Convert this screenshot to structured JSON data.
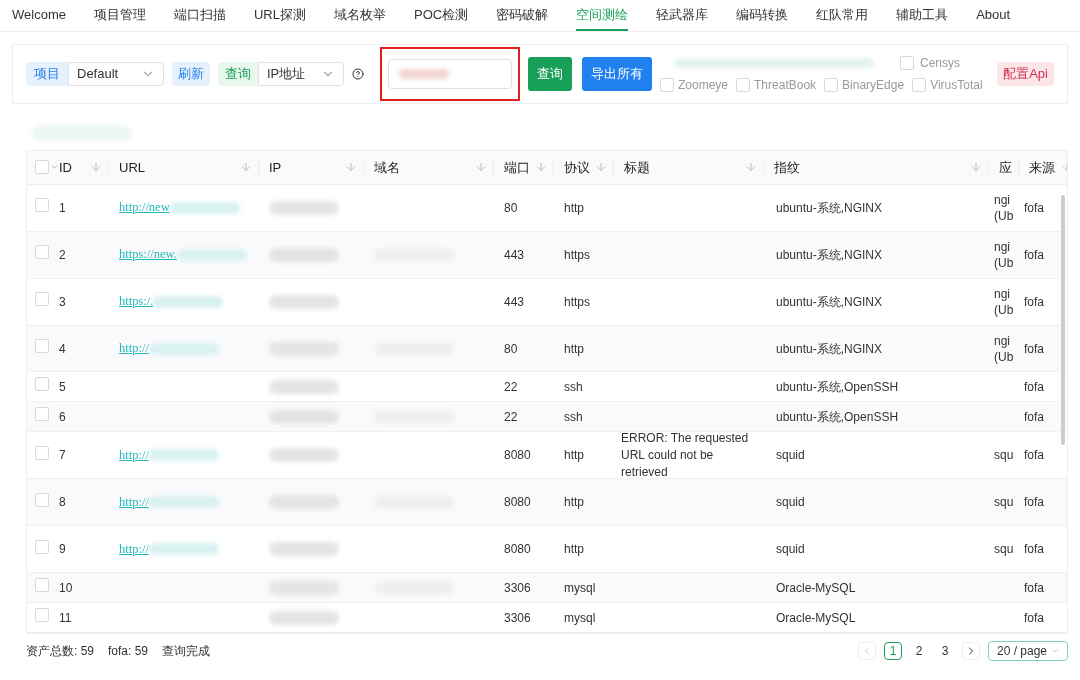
{
  "nav": [
    {
      "label": "Welcome",
      "selected": false
    },
    {
      "label": "项目管理",
      "selected": false
    },
    {
      "label": "端口扫描",
      "selected": false
    },
    {
      "label": "URL探测",
      "selected": false
    },
    {
      "label": "域名枚举",
      "selected": false
    },
    {
      "label": "POC检测",
      "selected": false
    },
    {
      "label": "密码破解",
      "selected": false
    },
    {
      "label": "空间测绘",
      "selected": true
    },
    {
      "label": "轻武器库",
      "selected": false
    },
    {
      "label": "编码转换",
      "selected": false
    },
    {
      "label": "红队常用",
      "selected": false
    },
    {
      "label": "辅助工具",
      "selected": false
    },
    {
      "label": "About",
      "selected": false
    }
  ],
  "toolbar": {
    "project": {
      "label": "项目",
      "value": "Default"
    },
    "refresh": "刷新",
    "query": {
      "label": "查询",
      "value": "IP地址"
    },
    "search_button": "查询",
    "export_button": "导出所有",
    "sources": [
      {
        "label": "Censys",
        "checked": false
      },
      {
        "label": "Zoomeye",
        "checked": false
      },
      {
        "label": "ThreatBook",
        "checked": false
      },
      {
        "label": "BinaryEdge",
        "checked": false
      },
      {
        "label": "VirusTotal",
        "checked": false
      }
    ],
    "config_button": "配置Api"
  },
  "table": {
    "all_checked": false,
    "columns": [
      "ID",
      "URL",
      "IP",
      "域名",
      "端口",
      "协议",
      "标题",
      "指纹",
      "应",
      "来源"
    ],
    "rows": [
      {
        "checked": false,
        "id": "1",
        "url": "http://new",
        "port": "80",
        "protocol": "http",
        "title": "",
        "fingerprint": "ubuntu-系统,NGINX",
        "app": "ngi (Ub",
        "source": "fofa"
      },
      {
        "checked": false,
        "id": "2",
        "url": "https://new.",
        "port": "443",
        "protocol": "https",
        "title": "",
        "fingerprint": "ubuntu-系统,NGINX",
        "app": "ngi (Ub",
        "source": "fofa"
      },
      {
        "checked": false,
        "id": "3",
        "url": "https:/.",
        "port": "443",
        "protocol": "https",
        "title": "",
        "fingerprint": "ubuntu-系统,NGINX",
        "app": "ngi (Ub",
        "source": "fofa"
      },
      {
        "checked": false,
        "id": "4",
        "url": "http://",
        "port": "80",
        "protocol": "http",
        "title": "",
        "fingerprint": "ubuntu-系统,NGINX",
        "app": "ngi (Ub",
        "source": "fofa"
      },
      {
        "checked": false,
        "id": "5",
        "url": "",
        "port": "22",
        "protocol": "ssh",
        "title": "",
        "fingerprint": "ubuntu-系统,OpenSSH",
        "app": "",
        "source": "fofa"
      },
      {
        "checked": false,
        "id": "6",
        "url": "",
        "port": "22",
        "protocol": "ssh",
        "title": "",
        "fingerprint": "ubuntu-系统,OpenSSH",
        "app": "",
        "source": "fofa"
      },
      {
        "checked": false,
        "id": "7",
        "url": "http://",
        "port": "8080",
        "protocol": "http",
        "title": "ERROR: The requested URL could not be retrieved",
        "fingerprint": "squid",
        "app": "squ",
        "source": "fofa"
      },
      {
        "checked": false,
        "id": "8",
        "url": "http://",
        "port": "8080",
        "protocol": "http",
        "title": "",
        "fingerprint": "squid",
        "app": "squ",
        "source": "fofa"
      },
      {
        "checked": false,
        "id": "9",
        "url": "http://",
        "port": "8080",
        "protocol": "http",
        "title": "",
        "fingerprint": "squid",
        "app": "squ",
        "source": "fofa"
      },
      {
        "checked": false,
        "id": "10",
        "url": "",
        "port": "3306",
        "protocol": "mysql",
        "title": "",
        "fingerprint": "Oracle-MySQL",
        "app": "",
        "source": "fofa"
      },
      {
        "checked": false,
        "id": "11",
        "url": "",
        "port": "3306",
        "protocol": "mysql",
        "title": "",
        "fingerprint": "Oracle-MySQL",
        "app": "",
        "source": "fofa"
      }
    ]
  },
  "footer": {
    "stats": [
      "资产总数: 59",
      "fofa: 59",
      "查询完成"
    ],
    "pages": [
      {
        "label": "1",
        "selected": true
      },
      {
        "label": "2",
        "selected": false
      },
      {
        "label": "3",
        "selected": false
      }
    ],
    "page_size": "20 / page"
  }
}
